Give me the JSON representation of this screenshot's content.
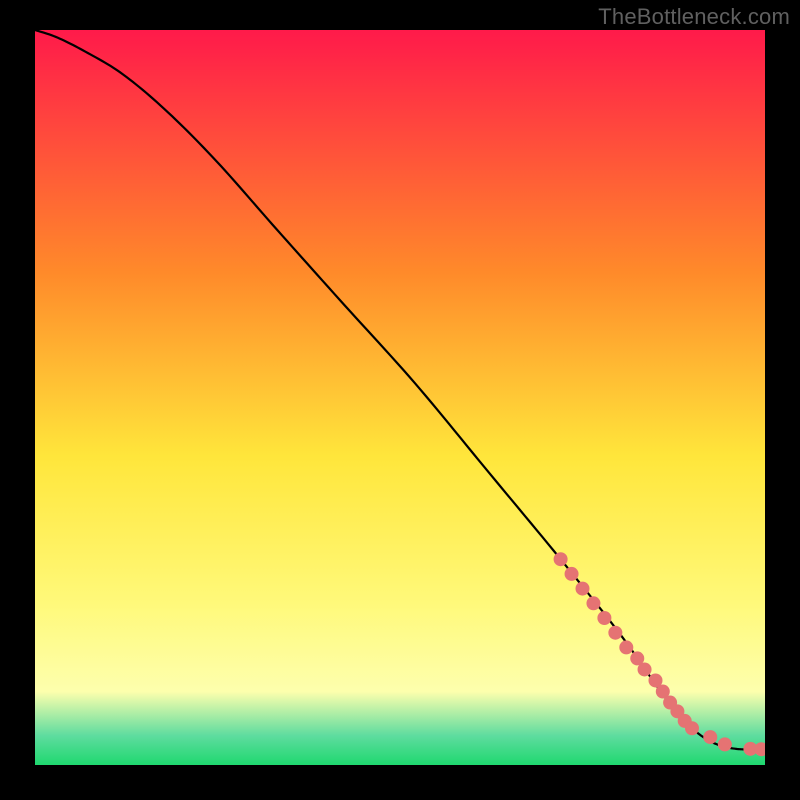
{
  "watermark": "TheBottleneck.com",
  "colors": {
    "gradient_top": "#ff1a4a",
    "gradient_mid1": "#ff8a2a",
    "gradient_mid2": "#ffe63b",
    "gradient_mid3": "#fff97a",
    "gradient_bottom_yellow": "#fdffad",
    "gradient_teal": "#5edc9f",
    "gradient_green": "#1fd86f",
    "curve": "#000000",
    "marker_fill": "#e57373",
    "marker_stroke": "#d15a5a",
    "background": "#000000"
  },
  "chart_data": {
    "type": "line",
    "title": "",
    "xlabel": "",
    "ylabel": "",
    "xlim": [
      0,
      100
    ],
    "ylim": [
      0,
      100
    ],
    "series": [
      {
        "name": "bottleneck-curve",
        "x": [
          0,
          3,
          7,
          12,
          18,
          25,
          33,
          42,
          52,
          62,
          72,
          80,
          85,
          88,
          90,
          92,
          94,
          96,
          98,
          100
        ],
        "y": [
          100,
          99,
          97,
          94,
          89,
          82,
          73,
          63,
          52,
          40,
          28,
          18,
          11,
          7,
          5,
          3.5,
          2.6,
          2.2,
          2.1,
          2.1
        ]
      }
    ],
    "markers": {
      "name": "data-points",
      "x": [
        72,
        73.5,
        75,
        76.5,
        78,
        79.5,
        81,
        82.5,
        83.5,
        85,
        86,
        87,
        88,
        89,
        90,
        92.5,
        94.5,
        98,
        99.5
      ],
      "y": [
        28,
        26,
        24,
        22,
        20,
        18,
        16,
        14.5,
        13,
        11.5,
        10,
        8.5,
        7.3,
        6,
        5,
        3.8,
        2.8,
        2.2,
        2.15
      ]
    },
    "marker_radius": 7
  }
}
